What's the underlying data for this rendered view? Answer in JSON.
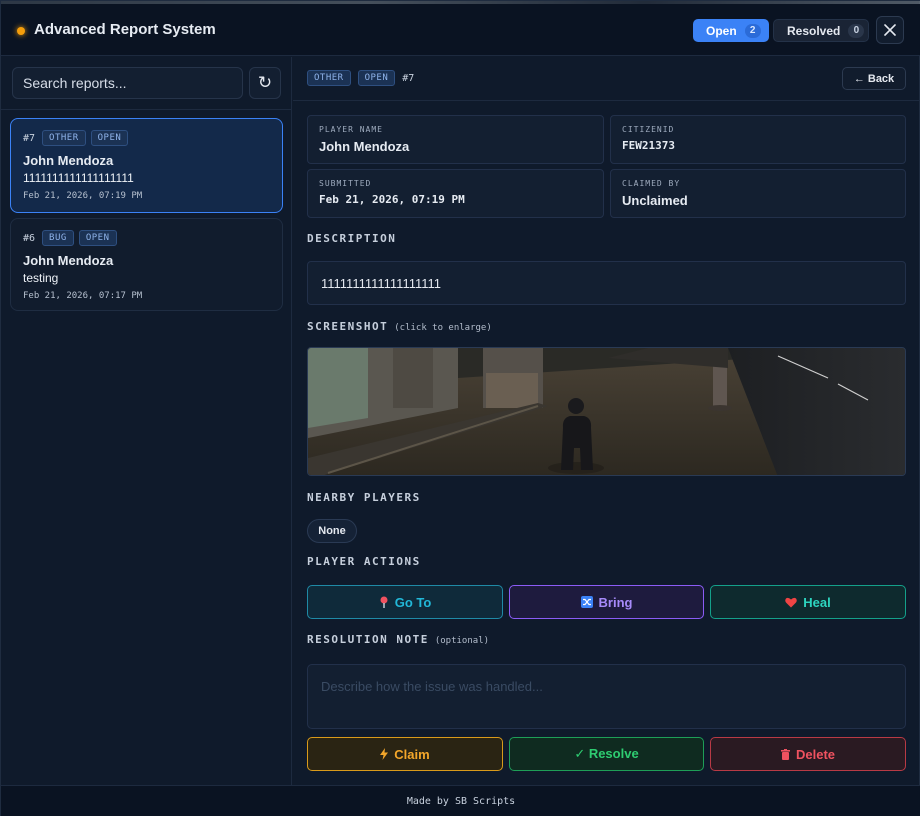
{
  "header": {
    "title": "Advanced Report System",
    "tabs": [
      {
        "label": "Open",
        "count": "2",
        "active": true
      },
      {
        "label": "Resolved",
        "count": "0",
        "active": false
      }
    ],
    "close_icon": "close-icon"
  },
  "sidebar": {
    "search_placeholder": "Search reports...",
    "refresh_icon": "refresh-icon",
    "reports": [
      {
        "number": "#7",
        "category": "OTHER",
        "status": "OPEN",
        "player": "John Mendoza",
        "message": "1111111111111111111",
        "date": "Feb 21, 2026, 07:19 PM",
        "selected": true
      },
      {
        "number": "#6",
        "category": "BUG",
        "status": "OPEN",
        "player": "John Mendoza",
        "message": "testing",
        "date": "Feb 21, 2026, 07:17 PM",
        "selected": false
      }
    ]
  },
  "detail": {
    "category": "OTHER",
    "status": "OPEN",
    "number": "#7",
    "back_label": "← Back",
    "player_name_label": "PLAYER NAME",
    "player_name": "John Mendoza",
    "citizenid_label": "CITIZENID",
    "citizenid": "FEW21373",
    "submitted_label": "SUBMITTED",
    "submitted": "Feb 21, 2026, 07:19 PM",
    "claimed_label": "CLAIMED BY",
    "claimed_by": "Unclaimed",
    "description_heading": "DESCRIPTION",
    "description": "1111111111111111111",
    "screenshot_heading": "SCREENSHOT",
    "screenshot_hint": "(click to enlarge)",
    "nearby_heading": "NEARBY PLAYERS",
    "nearby_none": "None",
    "actions_heading": "PLAYER ACTIONS",
    "actions": {
      "goto": {
        "label": "Go To",
        "icon": "pin-icon"
      },
      "bring": {
        "label": "Bring",
        "icon": "shuffle-icon"
      },
      "heal": {
        "label": "Heal",
        "icon": "heart-icon"
      }
    },
    "note_heading": "RESOLUTION NOTE",
    "note_hint": "(optional)",
    "note_placeholder": "Describe how the issue was handled...",
    "buttons": {
      "claim": {
        "label": "Claim",
        "icon": "lightning-icon"
      },
      "resolve": {
        "label": "✓ Resolve"
      },
      "delete": {
        "label": "Delete",
        "icon": "trash-icon"
      }
    }
  },
  "footer": {
    "text": "Made by SB Scripts"
  },
  "colors": {
    "accent": "#3b82f6",
    "status_dot": "#f59e0b",
    "claim": "#f3a62a",
    "resolve": "#2ecc71",
    "delete": "#f05260",
    "goto": "#22b8d8",
    "bring": "#a78bfa",
    "heal": "#2dd4bf"
  }
}
